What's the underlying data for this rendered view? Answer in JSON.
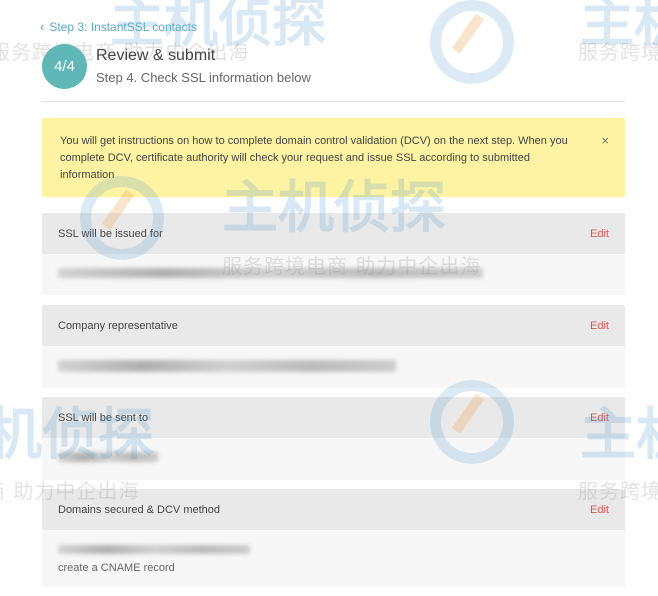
{
  "nav": {
    "back_label": "Step 3: InstantSSL contacts"
  },
  "step": {
    "badge": "4/4",
    "title": "Review & submit",
    "subtitle": "Step 4. Check SSL information below"
  },
  "notice": {
    "text": "You will get instructions on how to complete domain control validation (DCV) on the next step. When you complete DCV, certificate authority will check your request and issue SSL according to submitted information",
    "close_icon": "×"
  },
  "sections": [
    {
      "title": "SSL will be issued for",
      "edit_label": "Edit"
    },
    {
      "title": "Company representative",
      "edit_label": "Edit"
    },
    {
      "title": "SSL will be sent to",
      "edit_label": "Edit"
    },
    {
      "title": "Domains secured & DCV method",
      "edit_label": "Edit",
      "method": "create a CNAME record"
    }
  ],
  "watermark": {
    "brand": "主机侦探",
    "tagline": "服务跨境电商 助力中企出海"
  },
  "colors": {
    "badge": "#5fb7b7",
    "link": "#5aa9c6",
    "notice_bg": "#fdf3a3",
    "edit": "#d9534f"
  }
}
